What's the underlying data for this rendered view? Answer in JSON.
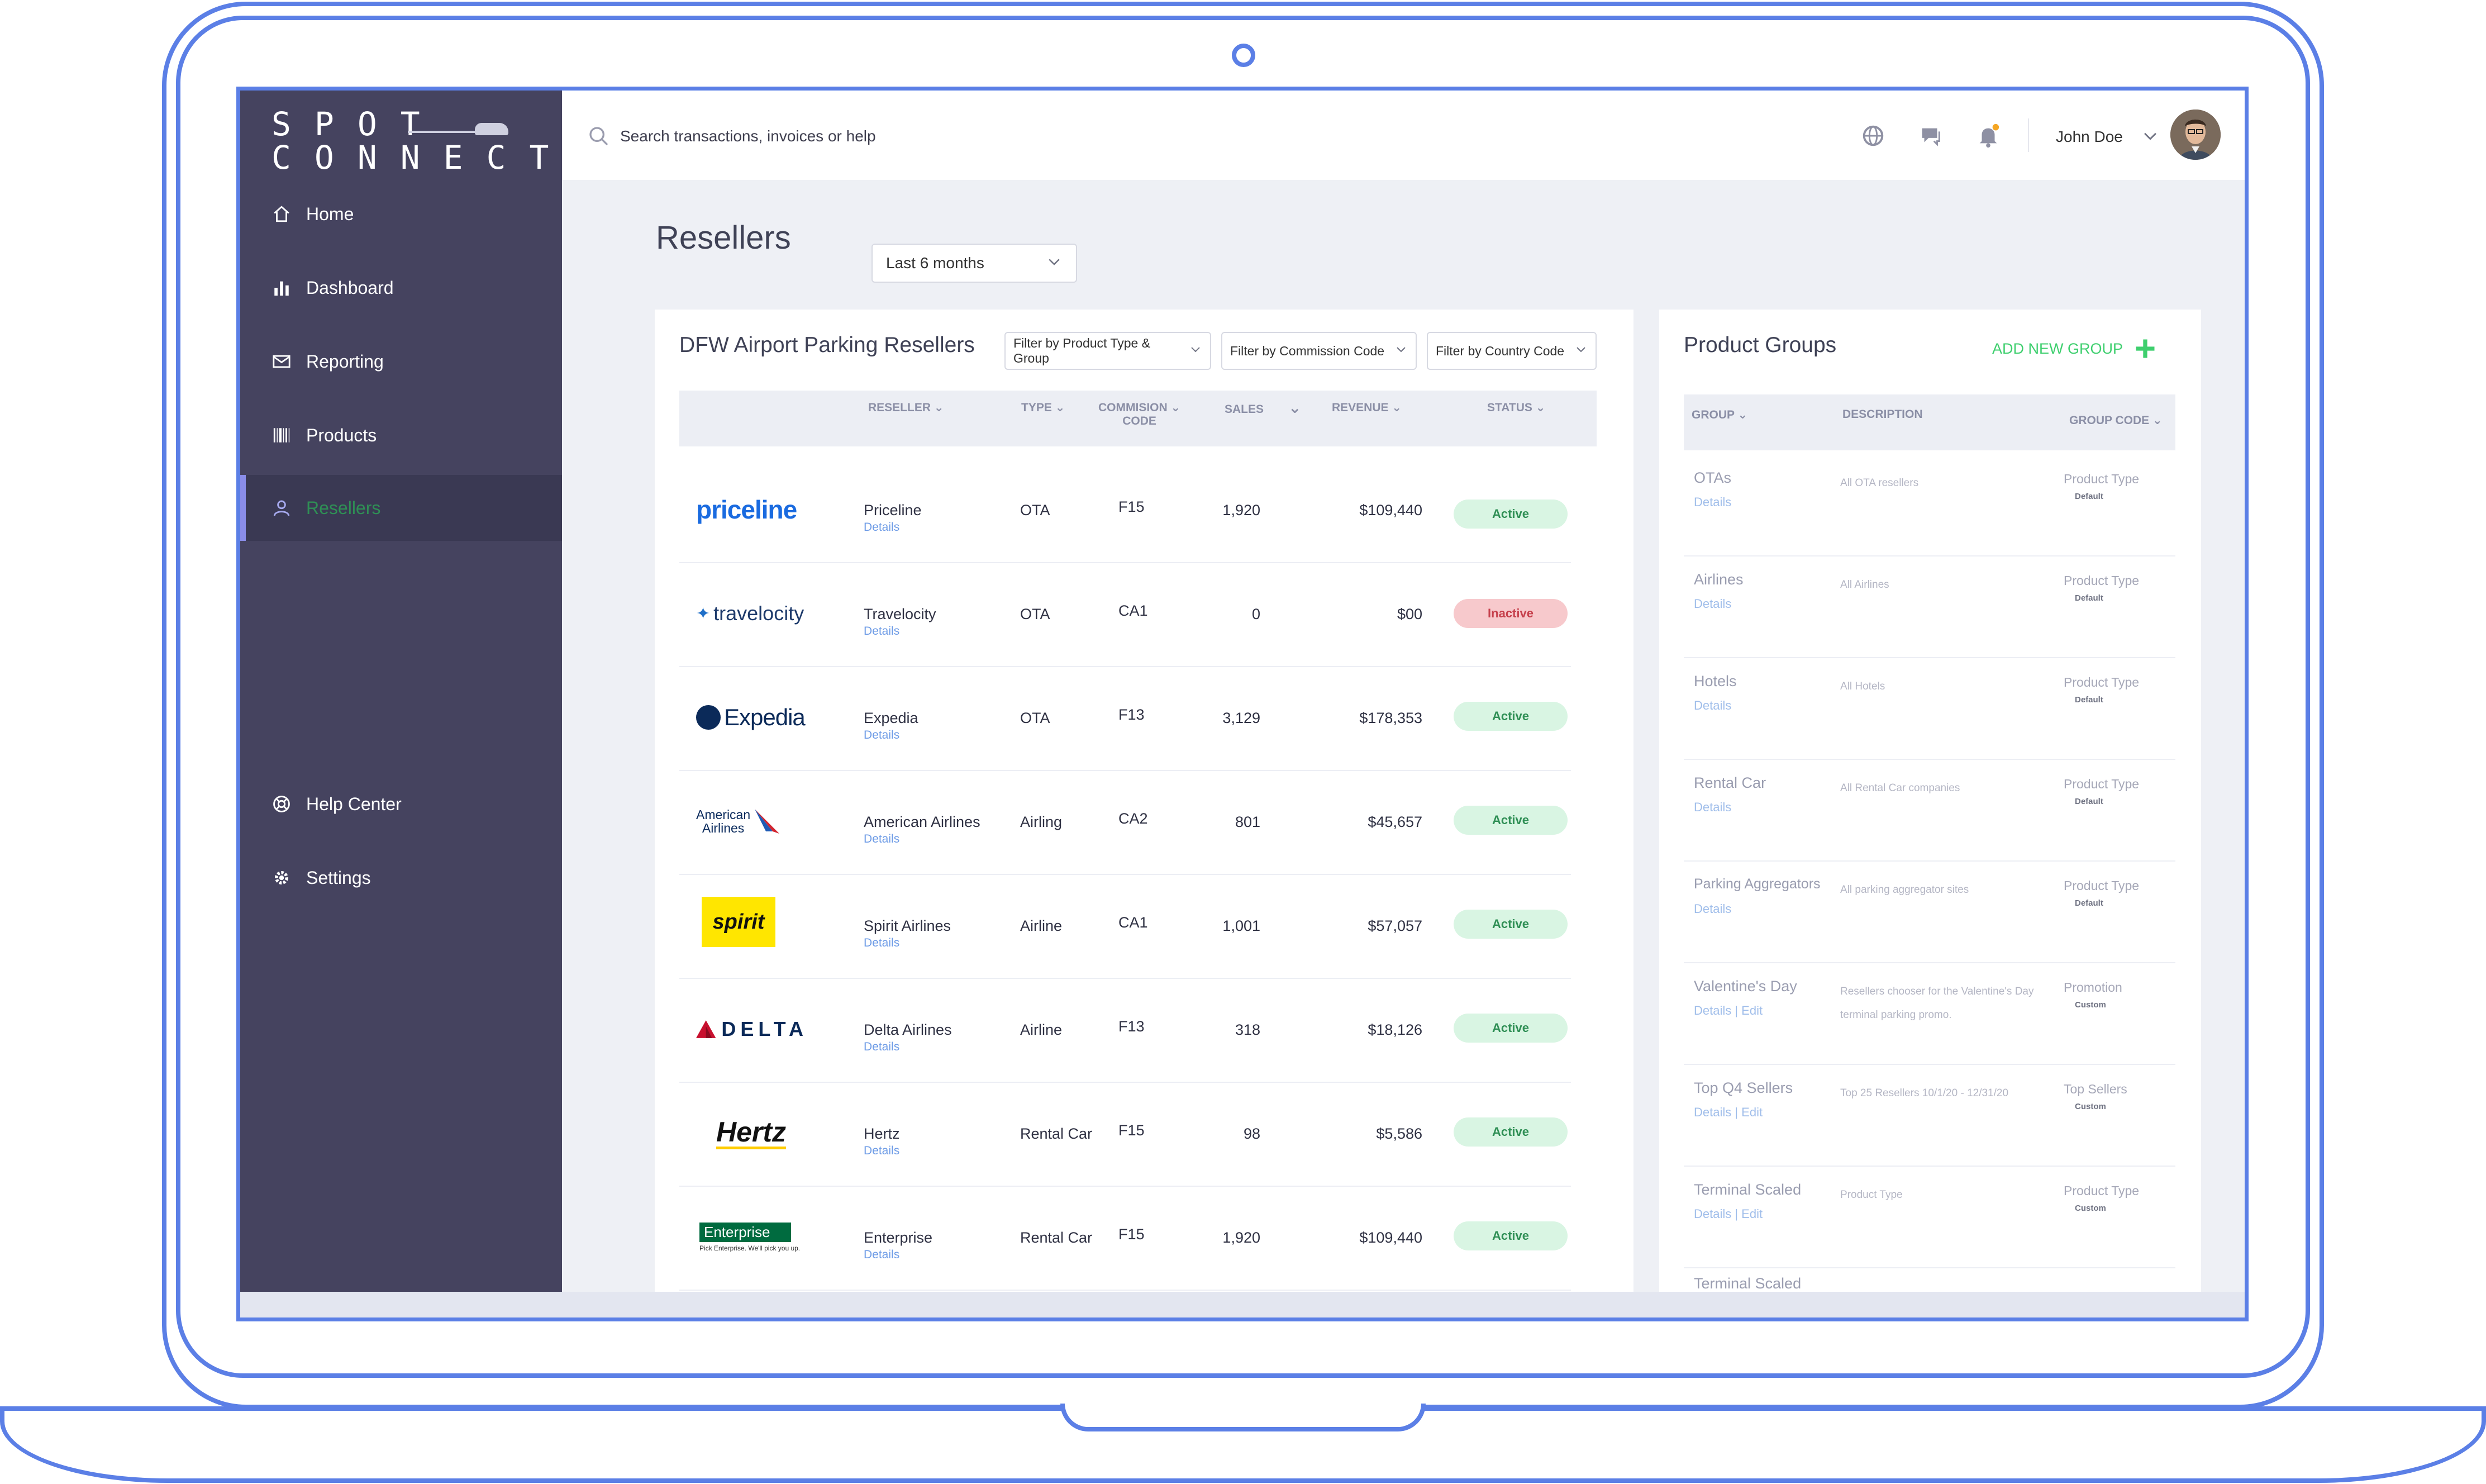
{
  "brand": {
    "line1": "SPOT",
    "line2": "CONNECT"
  },
  "sidebar": {
    "items": [
      {
        "label": "Home"
      },
      {
        "label": "Dashboard"
      },
      {
        "label": "Reporting"
      },
      {
        "label": "Products"
      },
      {
        "label": "Resellers"
      }
    ],
    "bottom_items": [
      {
        "label": "Help Center"
      },
      {
        "label": "Settings"
      }
    ]
  },
  "topbar": {
    "search_placeholder": "Search transactions, invoices or help",
    "user_name": "John Doe"
  },
  "page": {
    "title": "Resellers",
    "period": "Last 6 months"
  },
  "resellers_card": {
    "title": "DFW Airport Parking Resellers",
    "filters": [
      "Filter by Product Type & Group",
      "Filter by Commission Code",
      "Filter by Country Code"
    ],
    "columns": {
      "reseller": "RESELLER",
      "type": "TYPE",
      "code_line1": "COMMISION",
      "code_line2": "CODE",
      "sales": "SALES",
      "revenue": "REVENUE",
      "status": "STATUS"
    },
    "details_label": "Details",
    "rows": [
      {
        "logo": "priceline",
        "name": "Priceline",
        "type": "OTA",
        "code": "F15",
        "sales": "1,920",
        "revenue": "$109,440",
        "status": "Active"
      },
      {
        "logo": "travelocity",
        "name": "Travelocity",
        "type": "OTA",
        "code": "CA1",
        "sales": "0",
        "revenue": "$00",
        "status": "Inactive"
      },
      {
        "logo": "Expedia",
        "name": "Expedia",
        "type": "OTA",
        "code": "F13",
        "sales": "3,129",
        "revenue": "$178,353",
        "status": "Active"
      },
      {
        "logo_line1": "American",
        "logo_line2": "Airlines",
        "name": "American Airlines",
        "type": "Airling",
        "code": "CA2",
        "sales": "801",
        "revenue": "$45,657",
        "status": "Active"
      },
      {
        "logo": "spirit",
        "name": "Spirit Airlines",
        "type": "Airline",
        "code": "CA1",
        "sales": "1,001",
        "revenue": "$57,057",
        "status": "Active"
      },
      {
        "logo": "DELTA",
        "name": "Delta Airlines",
        "type": "Airline",
        "code": "F13",
        "sales": "318",
        "revenue": "$18,126",
        "status": "Active"
      },
      {
        "logo": "Hertz",
        "name": "Hertz",
        "type": "Rental Car",
        "code": "F15",
        "sales": "98",
        "revenue": "$5,586",
        "status": "Active"
      },
      {
        "logo": "Enterprise",
        "logo_sub": "Pick Enterprise. We'll pick you up.",
        "name": "Enterprise",
        "type": "Rental Car",
        "code": "F15",
        "sales": "1,920",
        "revenue": "$109,440",
        "status": "Active"
      }
    ]
  },
  "groups_card": {
    "title": "Product Groups",
    "add_label": "ADD NEW GROUP",
    "columns": {
      "group": "GROUP",
      "description": "DESCRIPTION",
      "code": "GROUP CODE"
    },
    "rows": [
      {
        "name": "OTAs",
        "link": "Details",
        "description": "All OTA resellers",
        "code": "Product Type",
        "kind": "Default"
      },
      {
        "name": "Airlines",
        "link": "Details",
        "description": "All Airlines",
        "code": "Product Type",
        "kind": "Default"
      },
      {
        "name": "Hotels",
        "link": "Details",
        "description": "All Hotels",
        "code": "Product Type",
        "kind": "Default"
      },
      {
        "name": "Rental Car",
        "link": "Details",
        "description": "All Rental Car companies",
        "code": "Product Type",
        "kind": "Default"
      },
      {
        "name": "Parking Aggregators",
        "link": "Details",
        "description": "All parking aggregator sites",
        "code": "Product Type",
        "kind": "Default"
      },
      {
        "name": "Valentine's Day",
        "link": "Details | Edit",
        "description": "Resellers chooser for the Valentine's Day terminal parking promo.",
        "code": "Promotion",
        "kind": "Custom"
      },
      {
        "name": "Top Q4 Sellers",
        "link": "Details | Edit",
        "description": "Top 25 Resellers 10/1/20 - 12/31/20",
        "code": "Top Sellers",
        "kind": "Custom"
      },
      {
        "name": "Terminal Scaled",
        "link": "Details | Edit",
        "description": "Product Type",
        "code": "Product Type",
        "kind": "Custom"
      },
      {
        "name": "Terminal Scaled",
        "link": "",
        "description": "",
        "code": "",
        "kind": ""
      }
    ]
  },
  "colors": {
    "sidebar": "#45435f",
    "accent": "#5b7fe6",
    "active": "#2f8f55",
    "inactive": "#c6404c",
    "add_green": "#3ecf6e"
  }
}
